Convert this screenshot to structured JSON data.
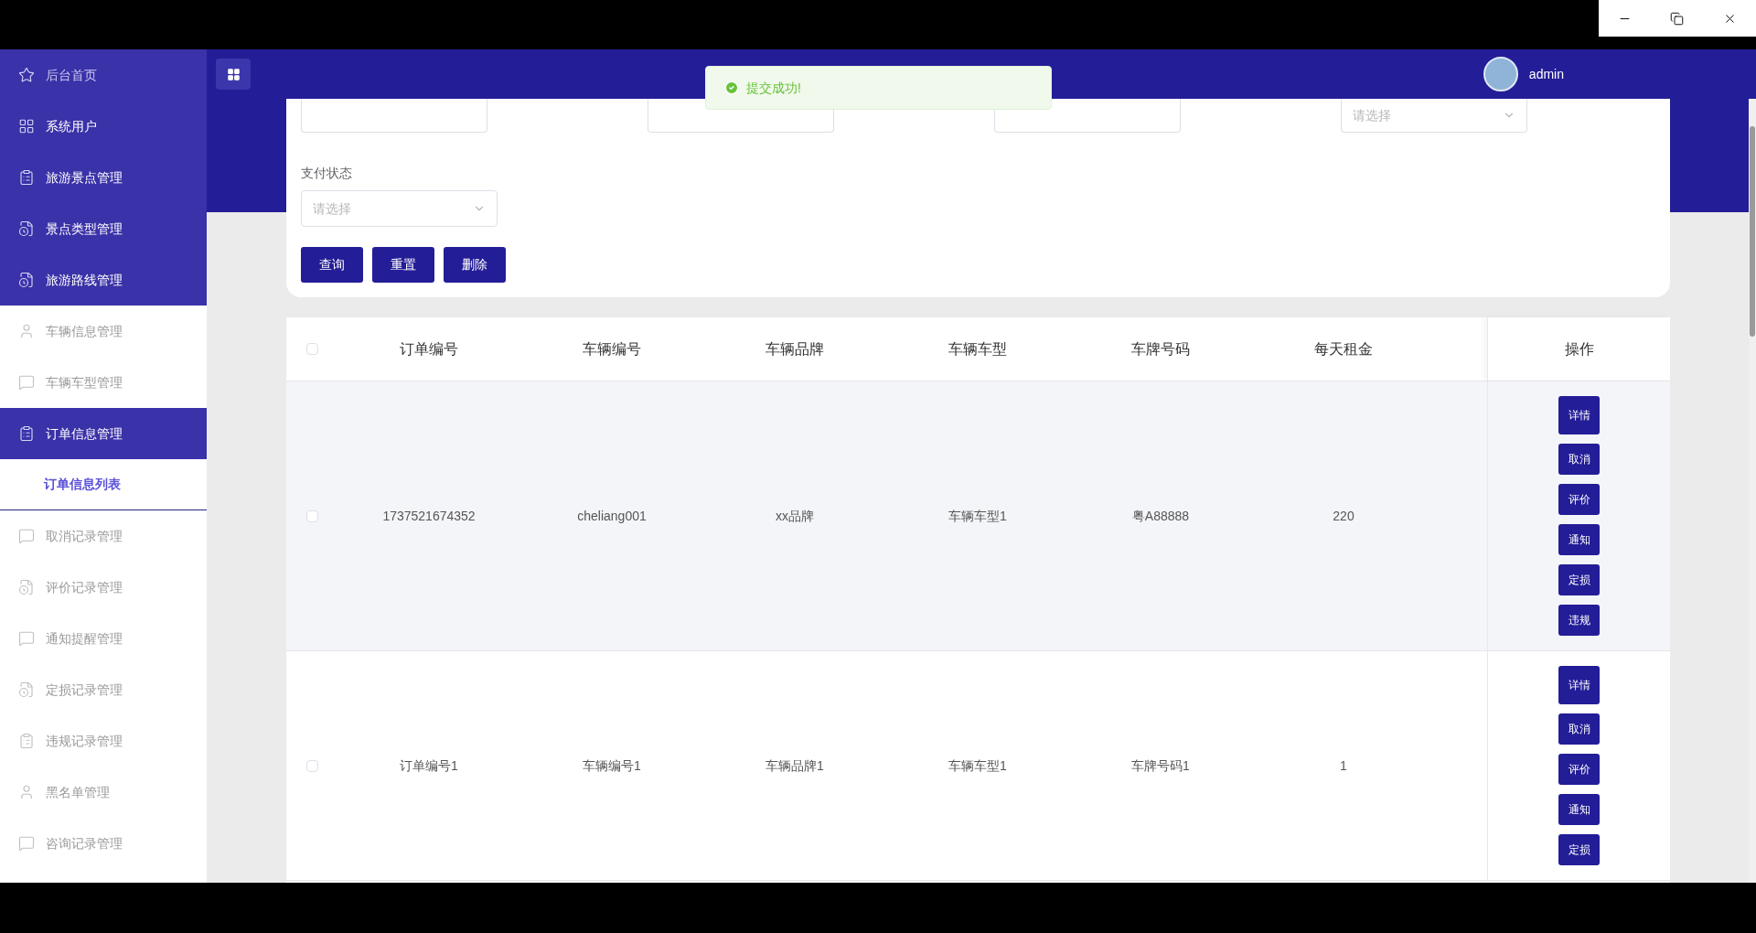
{
  "sidebar": {
    "top_items": [
      "后台首页",
      "系统用户",
      "旅游景点管理",
      "景点类型管理",
      "旅游路线管理"
    ],
    "items": [
      {
        "label": "车辆信息管理",
        "selected": false
      },
      {
        "label": "车辆车型管理",
        "selected": false
      },
      {
        "label": "订单信息管理",
        "selected": true,
        "children": [
          {
            "label": "订单信息列表",
            "selected": true
          }
        ]
      },
      {
        "label": "取消记录管理",
        "selected": false
      },
      {
        "label": "评价记录管理",
        "selected": false
      },
      {
        "label": "通知提醒管理",
        "selected": false
      },
      {
        "label": "定损记录管理",
        "selected": false
      },
      {
        "label": "违规记录管理",
        "selected": false
      },
      {
        "label": "黑名单管理",
        "selected": false
      },
      {
        "label": "咨询记录管理",
        "selected": false
      }
    ]
  },
  "header": {
    "user": "admin"
  },
  "toast": {
    "message": "提交成功!"
  },
  "search": {
    "top_fields": [
      {
        "kind": "input"
      },
      {
        "kind": "input"
      },
      {
        "kind": "input"
      },
      {
        "kind": "select",
        "placeholder": "请选择"
      }
    ],
    "pay_status": {
      "label": "支付状态",
      "placeholder": "请选择"
    },
    "buttons": [
      "查询",
      "重置",
      "删除"
    ]
  },
  "table": {
    "header_checked": false,
    "columns": [
      "订单编号",
      "车辆编号",
      "车辆品牌",
      "车辆车型",
      "车牌号码",
      "每天租金"
    ],
    "action_column": "操作",
    "rows": [
      {
        "cells": [
          "1737521674352",
          "cheliang001",
          "xx品牌",
          "车辆车型1",
          "粤A88888",
          "220"
        ],
        "checked": false,
        "actions": [
          "详情",
          "取消",
          "评价",
          "通知",
          "定损",
          "违规"
        ]
      },
      {
        "cells": [
          "订单编号1",
          "车辆编号1",
          "车辆品牌1",
          "车辆车型1",
          "车牌号码1",
          "1"
        ],
        "checked": false,
        "actions": [
          "详情",
          "取消",
          "评价",
          "通知",
          "定损"
        ]
      }
    ]
  }
}
